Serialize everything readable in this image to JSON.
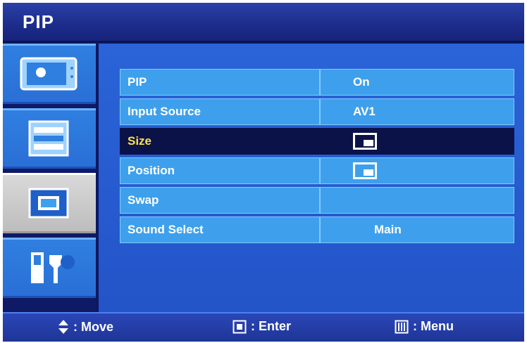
{
  "title": "PIP",
  "sidebar": {
    "items": [
      {
        "icon": "picture-settings-icon",
        "active": false
      },
      {
        "icon": "sound-settings-icon",
        "active": false
      },
      {
        "icon": "pip-icon",
        "active": true
      },
      {
        "icon": "setup-tools-icon",
        "active": false
      }
    ]
  },
  "menu": {
    "rows": [
      {
        "label": "PIP",
        "value": "On"
      },
      {
        "label": "Input Source",
        "value": "AV1"
      },
      {
        "label": "Size",
        "value": "",
        "value_icon": "pip-size-icon",
        "selected": true
      },
      {
        "label": "Position",
        "value": "",
        "value_icon": "pip-position-icon"
      },
      {
        "label": "Swap",
        "value": ""
      },
      {
        "label": "Sound Select",
        "value": "Main"
      }
    ]
  },
  "footer": {
    "move": ": Move",
    "enter": ": Enter",
    "menu": ": Menu"
  },
  "colors": {
    "selected_label": "#ffe34a",
    "row_bg": "#3ea0ec",
    "selected_bg": "#0b1248"
  }
}
